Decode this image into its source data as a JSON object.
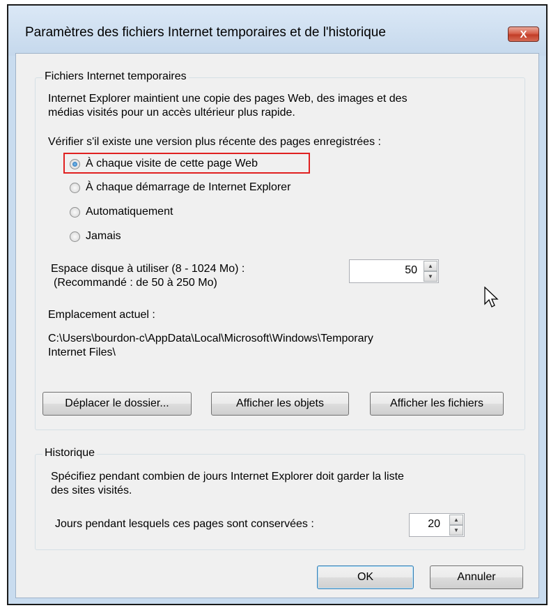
{
  "dialog": {
    "title": "Paramètres des fichiers Internet temporaires et de l'historique",
    "close_glyph": "X"
  },
  "temp_files": {
    "group_label": "Fichiers Internet temporaires",
    "description_line1": "Internet Explorer maintient une copie des pages Web, des images et des",
    "description_line2": "médias visités pour un accès ultérieur plus rapide.",
    "check_prompt": "Vérifier s'il existe une version plus récente des pages enregistrées :",
    "options": [
      {
        "label": "À chaque visite de cette page Web",
        "checked": true
      },
      {
        "label": "À chaque démarrage de Internet Explorer",
        "checked": false
      },
      {
        "label": "Automatiquement",
        "checked": false
      },
      {
        "label": "Jamais",
        "checked": false
      }
    ],
    "disk_space_label_line1": "Espace disque à utiliser (8 - 1024 Mo) :",
    "disk_space_label_line2": "(Recommandé : de 50 à 250 Mo)",
    "disk_space_value": "50",
    "location_label": "Emplacement actuel :",
    "location_path_line1": "C:\\Users\\bourdon-c\\AppData\\Local\\Microsoft\\Windows\\Temporary",
    "location_path_line2": "Internet Files\\",
    "buttons": {
      "move_folder": "Déplacer le dossier...",
      "view_objects": "Afficher les objets",
      "view_files": "Afficher les fichiers"
    }
  },
  "history": {
    "group_label": "Historique",
    "description_line1": "Spécifiez pendant combien de jours Internet Explorer doit garder la liste",
    "description_line2": "des sites visités.",
    "days_label": "Jours pendant lesquels ces pages sont conservées :",
    "days_value": "20"
  },
  "footer": {
    "ok_label": "OK",
    "cancel_label": "Annuler"
  },
  "colors": {
    "highlight": "#e02020",
    "close_button": "#c23d27",
    "dialog_background": "#f0f0f0"
  },
  "icons": [
    "close-icon",
    "spin-up-icon",
    "spin-down-icon",
    "mouse-cursor-icon"
  ]
}
